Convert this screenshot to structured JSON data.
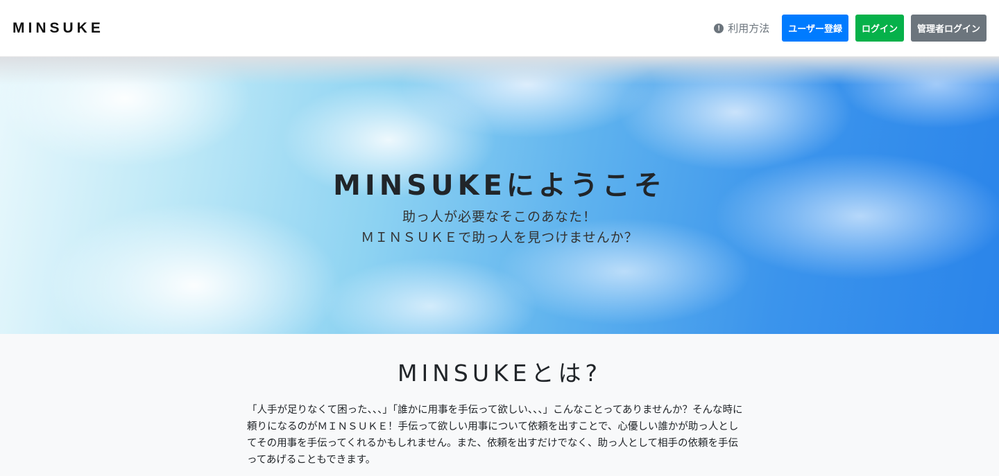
{
  "navbar": {
    "brand": "MINSUKE",
    "help_icon": "exclamation-circle-icon",
    "help_label": "利用方法",
    "register_label": "ユーザー登録",
    "login_label": "ログイン",
    "admin_login_label": "管理者ログイン"
  },
  "hero": {
    "title": "MINSUKEにようこそ",
    "subtitle_line1": "助っ人が必要なそこのあなた！",
    "subtitle_line2": "ＭＩＮＳＵＫＥで助っ人を見つけませんか？"
  },
  "about": {
    "title": "MINSUKEとは?",
    "body": "「人手が足りなくて困った、、、」「誰かに用事を手伝って欲しい、、、」こんなことってありませんか？そんな時に頼りになるのがＭＩＮＳＵＫＥ！手伝って欲しい用事について依頼を出すことで、心優しい誰かが助っ人としてその用事を手伝ってくれるかもしれません。また、依頼を出すだけでなく、助っ人として相手の依頼を手伝ってあげることもできます。"
  },
  "colors": {
    "primary": "#007bff",
    "success": "#06b14a",
    "secondary": "#6c757d"
  }
}
